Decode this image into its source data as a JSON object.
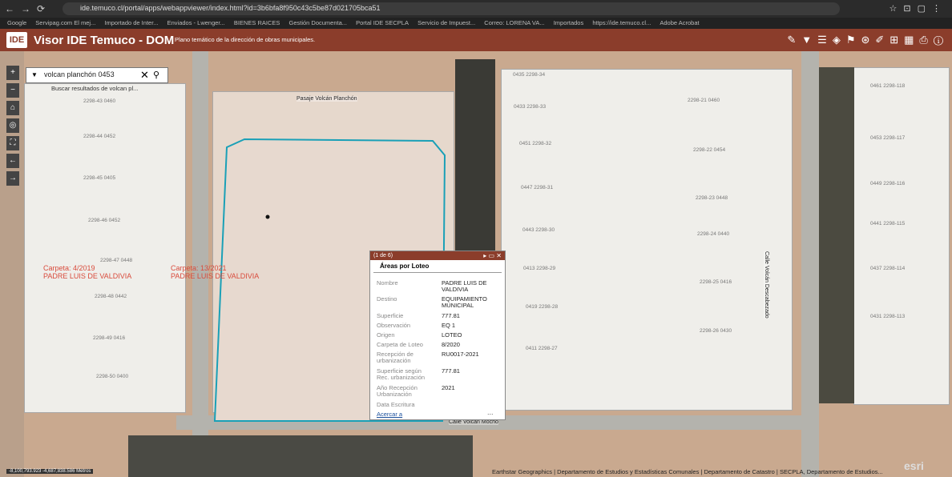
{
  "browser": {
    "url": "ide.temuco.cl/portal/apps/webappviewer/index.html?id=3b6bfa8f950c43c5be87d021705bca51",
    "nav": [
      "←",
      "→",
      "⟳"
    ],
    "bookmarks": [
      "Google",
      "Servipag.com El mej...",
      "Importado de Inter...",
      "Enviados - Lwenger...",
      "BIENES RAICES",
      "Gestión Documenta...",
      "Portal IDE SECPLA",
      "Servicio de Impuest...",
      "Correo: LORENA VA...",
      "Importados",
      "https://ide.temuco.cl...",
      "Adobe Acrobat"
    ]
  },
  "app": {
    "logo": "IDE",
    "title": "Visor IDE Temuco - DOM",
    "subtitle": "Plano temático de la dirección de obras municipales."
  },
  "search": {
    "value": "volcan planchón 0453",
    "hint": "Buscar resultados de volcan pl..."
  },
  "popup": {
    "header": "(1 de 6)",
    "title": "Áreas por Loteo",
    "fields": [
      {
        "k": "Nombre",
        "v": "PADRE LUIS DE VALDIVIA"
      },
      {
        "k": "Destino",
        "v": "EQUIPAMIENTO MUNICIPAL"
      },
      {
        "k": "Superficie",
        "v": "777.81"
      },
      {
        "k": "Observación",
        "v": "EQ 1"
      },
      {
        "k": "Origen",
        "v": "LOTEO"
      },
      {
        "k": "Carpeta de Loteo",
        "v": "8/2020"
      },
      {
        "k": "Recepción de urbanización",
        "v": "RU0017-2021"
      },
      {
        "k": "Superficie según Rec. urbanización",
        "v": "777.81"
      },
      {
        "k": "Año Recepción Urbanización",
        "v": "2021"
      },
      {
        "k": "Data Escritura",
        "v": ""
      }
    ],
    "link": "Acercar a",
    "more": "..."
  },
  "map": {
    "carpeta_left": "Carpeta: 4/2019",
    "carpeta_left_name": "PADRE LUIS DE VALDIVIA",
    "carpeta_mid": "Carpeta: 13/2021",
    "carpeta_mid_name": "PADRE LUIS DE VALDIVIA",
    "street_top": "Pasaje Volcán Planchón",
    "street_bottom": "Calle Volcán Mocho",
    "street_vertical": "Calle Volcán Descabezado",
    "parcels": [
      {
        "t": "2298-43 0460"
      },
      {
        "t": "2298-44 0452"
      },
      {
        "t": "2298-45 0405"
      },
      {
        "t": "2298-46 0452"
      },
      {
        "t": "2298-47 0448"
      },
      {
        "t": "2298-48 0442"
      },
      {
        "t": "2298-49 0416"
      },
      {
        "t": "2298-50 0400"
      },
      {
        "t": "0435 2298-34"
      },
      {
        "t": "0433 2298-33"
      },
      {
        "t": "0451 2298-32"
      },
      {
        "t": "0447 2298-31"
      },
      {
        "t": "0443 2298-30"
      },
      {
        "t": "0413 2298-29"
      },
      {
        "t": "0419 2298-28"
      },
      {
        "t": "0411 2298-27"
      },
      {
        "t": "2298-21 0460"
      },
      {
        "t": "2298-22 0454"
      },
      {
        "t": "2298-23 0448"
      },
      {
        "t": "2298-24 0440"
      },
      {
        "t": "2298-25 0416"
      },
      {
        "t": "2298-26 0430"
      },
      {
        "t": "0461 2298-118"
      },
      {
        "t": "0453 2298-117"
      },
      {
        "t": "0449 2298-116"
      },
      {
        "t": "0441 2298-115"
      },
      {
        "t": "0437 2298-114"
      },
      {
        "t": "0431 2298-113"
      }
    ]
  },
  "status": {
    "coords": "-8,100,793.923 -4,687,838.586 Metros",
    "esri": "esri"
  },
  "attribution": "Earthstar Geographics | Departamento de Estudios y Estadísticas Comunales | Departamento de Catastro | SECPLA, Departamento de Estudios..."
}
